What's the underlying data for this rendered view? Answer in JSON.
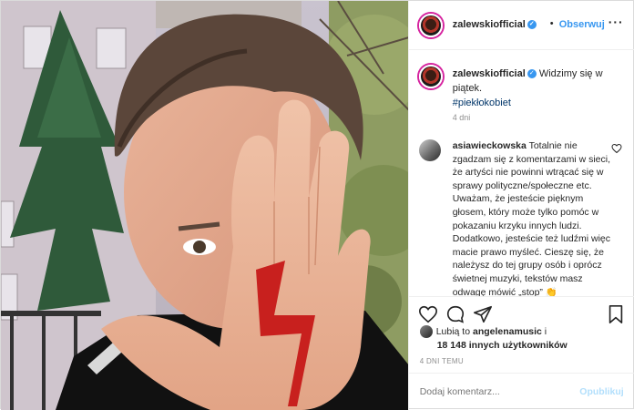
{
  "post": {
    "username": "zalewskiofficial",
    "verified_glyph": "✓",
    "dot": "•",
    "follow_label": "Obserwuj",
    "more_icon": "more-horizontal-icon",
    "more_label": "···"
  },
  "caption": {
    "username": "zalewskiofficial",
    "text": "Widzimy się w piątek.",
    "hashtag": "#piekłokobiet",
    "time": "4 dni"
  },
  "comment": {
    "username": "asiawieckowska",
    "text": "Totalnie nie zgadzam się z komentarzami w sieci, że artyści nie powinni wtrącać się w sprawy polityczne/społeczne etc. Uważam, że jesteście pięknym głosem, który może tylko pomóc w pokazaniu krzyku innych ludzi. Dodatkowo, jesteście też ludźmi więc macie prawo myśleć. Cieszę się, że należysz do tej grupy osób i oprócz świetnej muzyki, tekstów masz odwagę mówić „stop”",
    "emoji": "👏"
  },
  "likes": {
    "prefix": "Lubią to",
    "liker": "angelenamusic",
    "conjunction": "i",
    "others": "18 148 innych użytkowników"
  },
  "post_time": "4 DNI TEMU",
  "add_comment": {
    "placeholder": "Dodaj komentarz...",
    "publish_label": "Opublikuj"
  },
  "colors": {
    "link_blue": "#3897f0",
    "hashtag_blue": "#003569",
    "muted_gray": "#8e8e8e",
    "publish_disabled": "#b2dffc",
    "lightning_red": "#c8201e"
  }
}
